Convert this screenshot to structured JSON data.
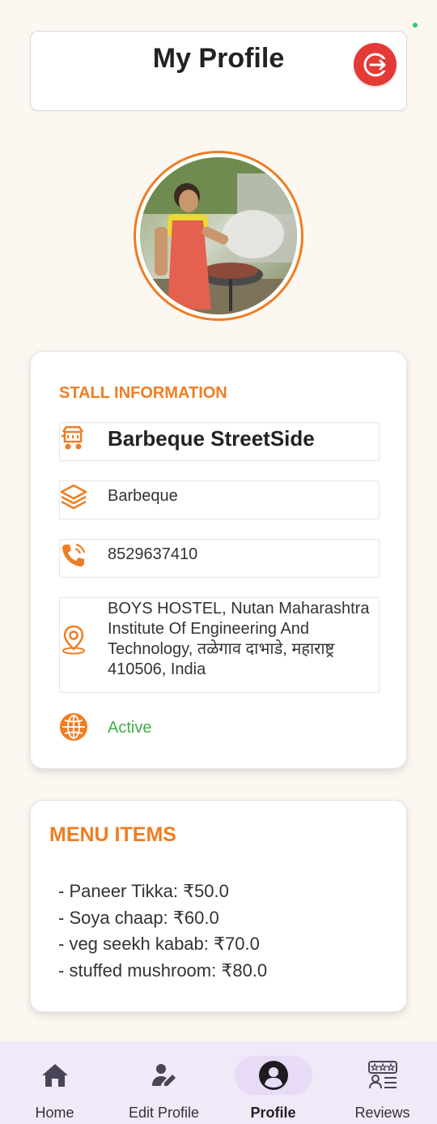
{
  "header": {
    "title": "My Profile",
    "logout_icon": "logout-icon",
    "logout_color": "#e53935"
  },
  "profile": {
    "avatar_description": "stall owner photo"
  },
  "stall_info": {
    "section_title": "STALL INFORMATION",
    "name": "Barbeque StreetSide",
    "category": "Barbeque",
    "phone": "8529637410",
    "address_line1": "BOYS HOSTEL, Nutan Maharashtra",
    "address_line2": "Institute Of Engineering And",
    "address_line3": "Technology, तळेगाव दाभाडे, महाराष्ट्र",
    "address_line4": "410506, India",
    "status": "Active",
    "accent_color": "#ef7d22",
    "status_color": "#3fae49"
  },
  "menu": {
    "title": "MENU ITEMS",
    "items": [
      "- Paneer Tikka: ₹50.0",
      "- Soya chaap: ₹60.0",
      "- veg seekh kabab: ₹70.0",
      "- stuffed mushroom: ₹80.0"
    ]
  },
  "nav": {
    "items": [
      {
        "label": "Home",
        "icon": "home-icon"
      },
      {
        "label": "Edit Profile",
        "icon": "edit-profile-icon"
      },
      {
        "label": "Profile",
        "icon": "profile-icon"
      },
      {
        "label": "Reviews",
        "icon": "reviews-icon"
      }
    ],
    "active_index": 2
  }
}
